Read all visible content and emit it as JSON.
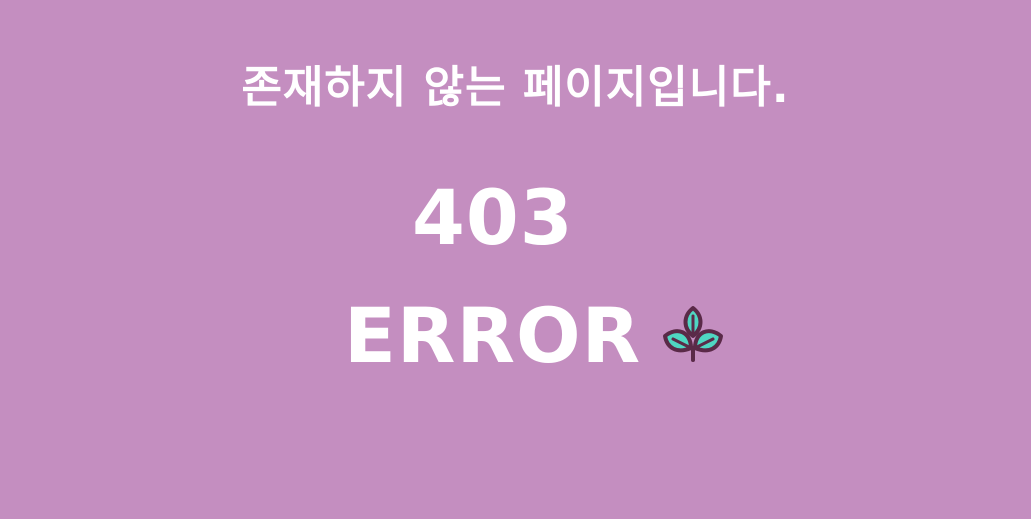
{
  "page": {
    "message": "존재하지 않는 페이지입니다.",
    "code": "403",
    "error_label": "ERROR",
    "icon": "leaves-icon"
  },
  "colors": {
    "background": "#c48ec0",
    "text": "#ffffff",
    "leaf_fill": "#4fd6c2",
    "leaf_outline": "#5a2a48"
  }
}
